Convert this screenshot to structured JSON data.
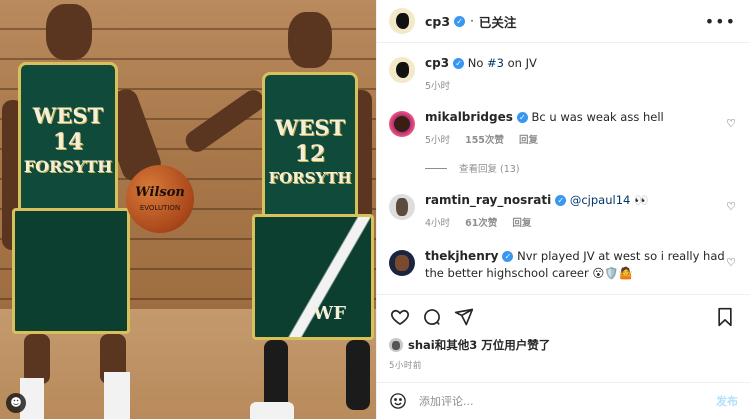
{
  "post": {
    "author": "cp3",
    "follow_dot": "·",
    "follow_label": "已关注",
    "more_label": "•••",
    "caption": {
      "username": "cp3",
      "text_prefix": "No ",
      "hashtag": "#3",
      "text_suffix": " on JV",
      "time": "5小时"
    }
  },
  "photo": {
    "jersey_left": {
      "line1": "WEST",
      "number": "14",
      "line2": "FORSYTH"
    },
    "jersey_right": {
      "line1": "WEST",
      "number": "12",
      "line2": "FORSYTH",
      "shorts_logo": "WF"
    },
    "ball_brand": "Wilson",
    "ball_model": "EVOLUTION"
  },
  "comments": [
    {
      "username": "mikalbridges",
      "verified": true,
      "text": "Bc u was weak ass hell",
      "time": "5小时",
      "likes": "155次赞",
      "reply_label": "回复",
      "view_replies": "查看回复 (13)"
    },
    {
      "username": "ramtin_ray_nosrati",
      "verified": true,
      "mention": "@cjpaul14",
      "emoji": "👀",
      "time": "4小时",
      "likes": "61次赞",
      "reply_label": "回复"
    },
    {
      "username": "thekjhenry",
      "verified": true,
      "text": "Nvr played JV at west so i really had the better highschool career",
      "emoji": "😮🛡️🤷",
      "time": "",
      "likes": "",
      "reply_label": ""
    }
  ],
  "actions": {
    "liked_by_user": "shai",
    "liked_by_text": "和其他3 万位用户赞了",
    "time": "5小时前"
  },
  "add_comment": {
    "placeholder": "添加评论...",
    "post_label": "发布"
  },
  "colors": {
    "link": "#00376b",
    "verified": "#3897f0",
    "muted": "#8e8e8e",
    "post_button": "#b2dffc"
  }
}
